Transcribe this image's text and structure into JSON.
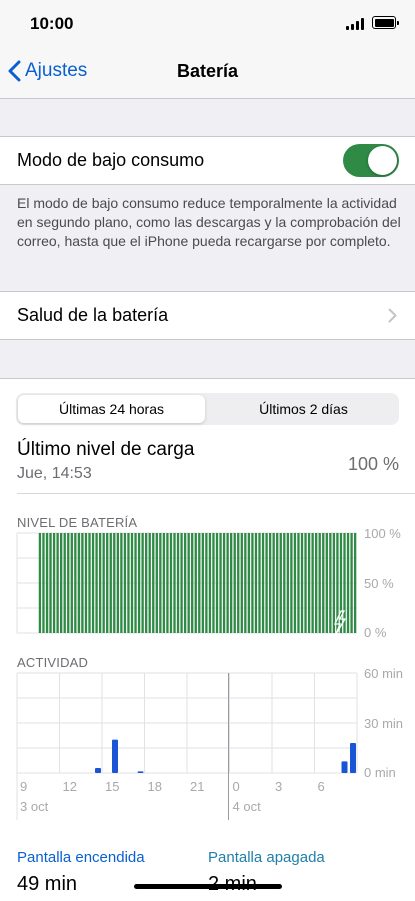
{
  "status_bar": {
    "time": "10:00"
  },
  "nav": {
    "back_label": "Ajustes",
    "title": "Batería"
  },
  "low_power": {
    "label": "Modo de bajo consumo",
    "enabled": true,
    "footnote": "El modo de bajo consumo reduce temporalmente la actividad en segundo plano, como las descargas y la comprobación del correo, hasta que el iPhone pueda recargarse por completo."
  },
  "battery_health": {
    "label": "Salud de la batería"
  },
  "segments": {
    "options": [
      "Últimas 24 horas",
      "Últimos 2 días"
    ],
    "selected_index": 0
  },
  "last_charge": {
    "title": "Último nivel de carga",
    "date": "Jue, 14:53",
    "value": "100 %"
  },
  "level_chart": {
    "label": "NIVEL DE BATERÍA",
    "y_ticks": [
      "100 %",
      "50 %",
      "0 %"
    ],
    "color": "#2f8a46"
  },
  "activity_chart": {
    "label": "ACTIVIDAD",
    "y_ticks": [
      "60 min",
      "30 min",
      "0 min"
    ],
    "x_ticks": [
      "9",
      "12",
      "15",
      "18",
      "21",
      "0",
      "3",
      "6"
    ],
    "day_labels": [
      "3 oct",
      "4 oct"
    ],
    "color": "#1a55d6"
  },
  "screen": {
    "on_label": "Pantalla encendida",
    "on_value": "49 min",
    "off_label": "Pantalla apagada",
    "off_value": "2 min",
    "on_color": "#0a60d0",
    "off_color": "#1f7fa8"
  },
  "chart_data": [
    {
      "type": "bar",
      "title": "NIVEL DE BATERÍA",
      "ylabel": "",
      "ylim": [
        0,
        100
      ],
      "series": [
        {
          "values": [
            0,
            0,
            0,
            0,
            0,
            0,
            100,
            100,
            100,
            100,
            100,
            100,
            100,
            100,
            100,
            100,
            100,
            100,
            100,
            100,
            100,
            100,
            100,
            100,
            100,
            100,
            100,
            100,
            100,
            100,
            100,
            100,
            100,
            100,
            100,
            100,
            100,
            100,
            100,
            100,
            100,
            100,
            100,
            100,
            100,
            100,
            100,
            100,
            100,
            100,
            100,
            100,
            100,
            100,
            100,
            100,
            100,
            100,
            100,
            100,
            100,
            100,
            100,
            100,
            100,
            100,
            100,
            100,
            100,
            100,
            100,
            100,
            100,
            100,
            100,
            100,
            100,
            100,
            100,
            100,
            100,
            100,
            100,
            100,
            100,
            100,
            100,
            100,
            100,
            100,
            100,
            100,
            100,
            100,
            100,
            100
          ]
        }
      ]
    },
    {
      "type": "bar",
      "title": "ACTIVIDAD",
      "ylabel": "",
      "ylim": [
        0,
        60
      ],
      "categories": [
        "9",
        "12",
        "15",
        "18",
        "21",
        "0",
        "3",
        "6"
      ],
      "series": [
        {
          "values": [
            0,
            0,
            0,
            0,
            0,
            0,
            0,
            0,
            0,
            3,
            0,
            20,
            0,
            0,
            1,
            0,
            0,
            0,
            0,
            0,
            0,
            0,
            0,
            0,
            0,
            0,
            0,
            0,
            0,
            0,
            0,
            0,
            0,
            0,
            0,
            0,
            0,
            0,
            7,
            18
          ]
        }
      ]
    }
  ]
}
